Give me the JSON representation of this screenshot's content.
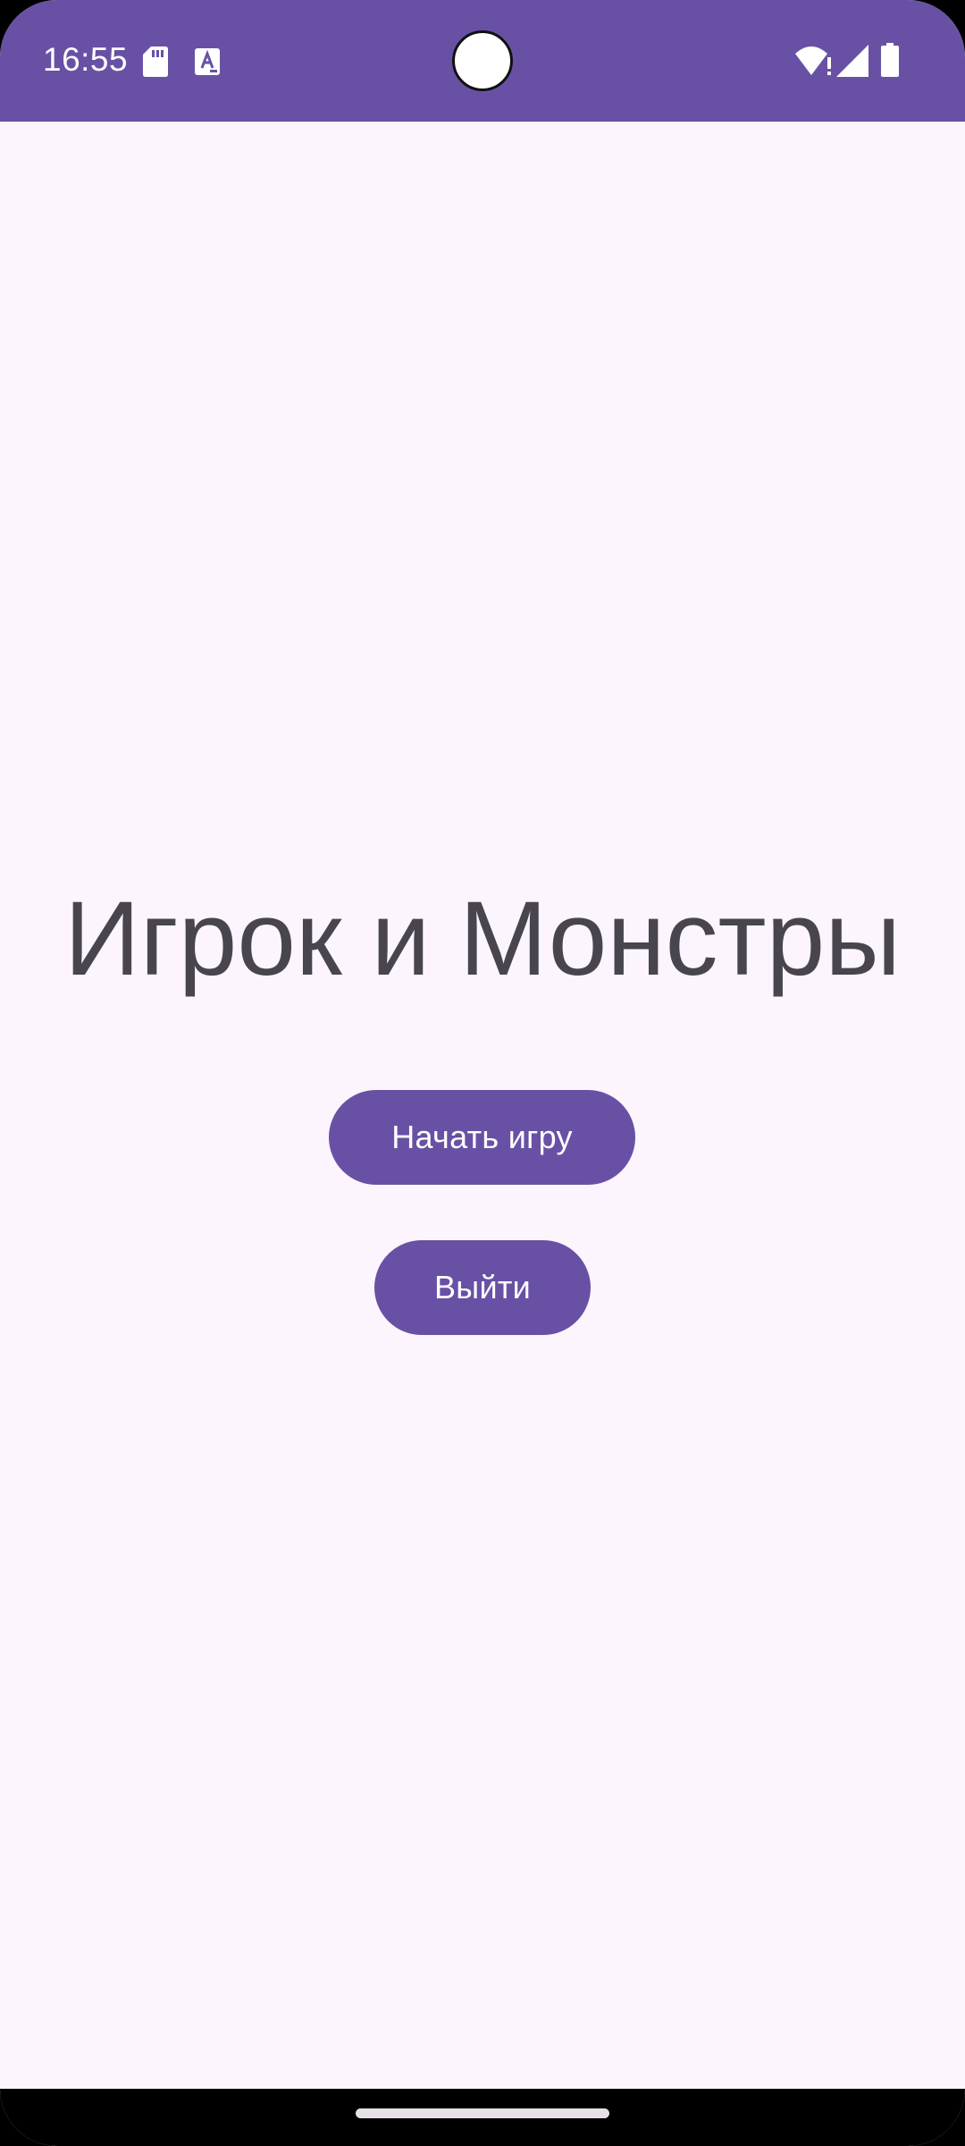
{
  "status_bar": {
    "time": "16:55",
    "icons": [
      "sd-card-icon",
      "font-download-icon",
      "wifi-alert-icon",
      "cell-signal-icon",
      "battery-icon"
    ]
  },
  "main": {
    "title": "Игрок и Монстры",
    "start_button_label": "Начать игру",
    "exit_button_label": "Выйти"
  },
  "colors": {
    "primary": "#6851A5",
    "background": "#FCF5FD",
    "title_text": "#49454F",
    "button_text": "#FFFFFF"
  }
}
